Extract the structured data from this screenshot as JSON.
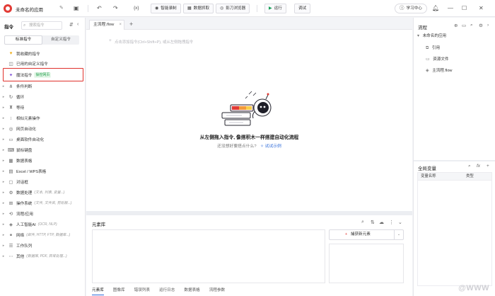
{
  "topbar": {
    "app_title": "未命名的应用",
    "smart_record": "智能录制",
    "data_capture": "数据抓取",
    "browser": "影刀浏览器",
    "run": "运行",
    "debug": "调试",
    "learning_center": "学习中心"
  },
  "left": {
    "title": "指令",
    "search_placeholder": "搜索指令",
    "seg_standard": "标准指令",
    "seg_custom": "自定义指令",
    "items": [
      {
        "label": "我收藏的指令",
        "sub": "",
        "badge": "",
        "icon": "heart-icon"
      },
      {
        "label": "已用的自定义指令",
        "sub": "",
        "badge": "",
        "icon": "custom-cmd-icon"
      },
      {
        "label": "魔法指令",
        "sub": "",
        "badge": "操控网页",
        "icon": "magic-wand-icon"
      },
      {
        "label": "条件判断",
        "sub": "",
        "badge": "",
        "icon": "condition-icon"
      },
      {
        "label": "循环",
        "sub": "",
        "badge": "",
        "icon": "loop-icon"
      },
      {
        "label": "等待",
        "sub": "",
        "badge": "",
        "icon": "hourglass-icon"
      },
      {
        "label": "相似元素操作",
        "sub": "",
        "badge": "",
        "icon": "similar-elements-icon"
      },
      {
        "label": "网页自动化",
        "sub": "",
        "badge": "",
        "icon": "web-icon"
      },
      {
        "label": "桌面软件自动化",
        "sub": "",
        "badge": "",
        "icon": "desktop-icon"
      },
      {
        "label": "鼠标键盘",
        "sub": "",
        "badge": "",
        "icon": "mouse-icon"
      },
      {
        "label": "数据表格",
        "sub": "",
        "badge": "",
        "icon": "table-icon"
      },
      {
        "label": "Excel / WPS表格",
        "sub": "",
        "badge": "",
        "icon": "excel-icon"
      },
      {
        "label": "对话框",
        "sub": "",
        "badge": "",
        "icon": "dialog-icon"
      },
      {
        "label": "数据处理",
        "sub": "(文本, 列表, 变量...)",
        "badge": "",
        "icon": "data-process-icon"
      },
      {
        "label": "操作系统",
        "sub": "(文件, 文件夹, 剪贴板...)",
        "badge": "",
        "icon": "os-icon"
      },
      {
        "label": "流程/应用",
        "sub": "",
        "badge": "",
        "icon": "flow-app-icon"
      },
      {
        "label": "人工智能AI",
        "sub": "(OCR, NLP)",
        "badge": "",
        "icon": "ai-icon"
      },
      {
        "label": "网络",
        "sub": "(邮件, HTTP, FTP, 数据库...)",
        "badge": "",
        "icon": "network-icon"
      },
      {
        "label": "工作队列",
        "sub": "",
        "badge": "",
        "icon": "queue-icon"
      },
      {
        "label": "其他",
        "sub": "(数据库, PDF, 异常处理...)",
        "badge": "",
        "icon": "other-icon"
      }
    ]
  },
  "editor": {
    "tab_name": "主流程.flow",
    "hint": "点击添加指令(Ctrl+Shift+P), 或从左侧拖拽指令",
    "empty_title": "从左侧拖入指令, 像搭积木一样搭建自动化流程",
    "empty_sub": "还没想好要搭点什么?",
    "try_example": "试试示例"
  },
  "elements": {
    "title": "元素库",
    "capture": "捕获新元素",
    "tabs": [
      "元素库",
      "图像库",
      "错误列表",
      "运行日志",
      "数据表格",
      "流程参数"
    ]
  },
  "right": {
    "title": "流程",
    "tree_root": "未命名的应用",
    "tree_items": [
      "引用",
      "资源文件",
      "主流程.flow"
    ],
    "global_vars_title": "全局变量",
    "col_name": "变量名称",
    "col_type": "类型"
  },
  "watermark": "@WWW",
  "colors": {
    "accent_blue": "#2f6bd9",
    "highlight_red": "#e0312c",
    "run_green": "#18a058",
    "logo_red": "#e23b35"
  }
}
